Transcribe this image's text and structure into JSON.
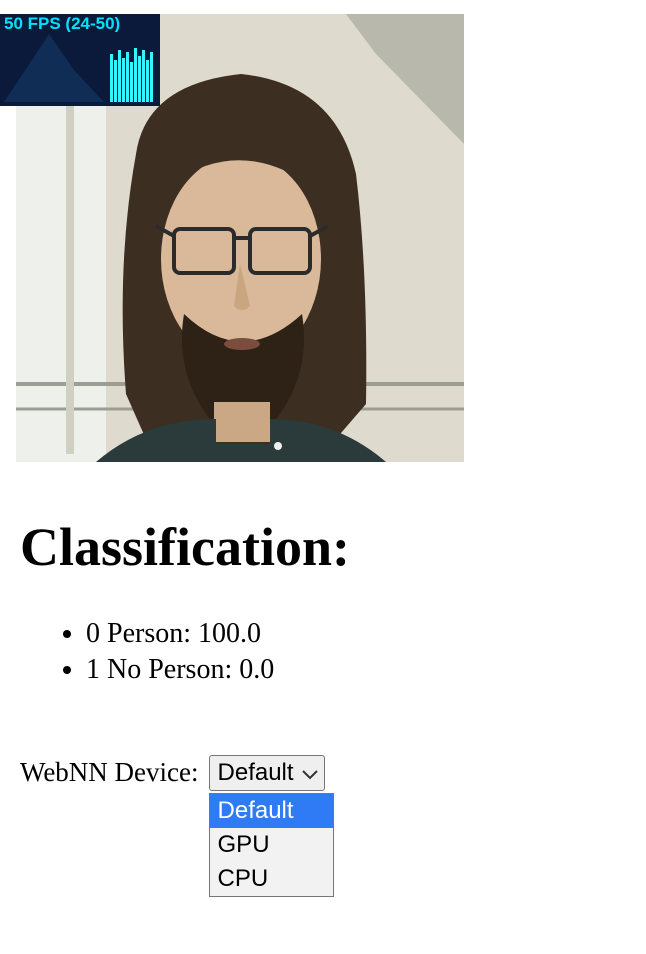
{
  "fps": {
    "label": "50 FPS (24-50)"
  },
  "classification": {
    "heading": "Classification:",
    "results": [
      {
        "text": "0 Person: 100.0"
      },
      {
        "text": "1 No Person: 0.0"
      }
    ]
  },
  "device": {
    "label": "WebNN Device:",
    "selected": "Default",
    "options": [
      "Default",
      "GPU",
      "CPU"
    ]
  }
}
